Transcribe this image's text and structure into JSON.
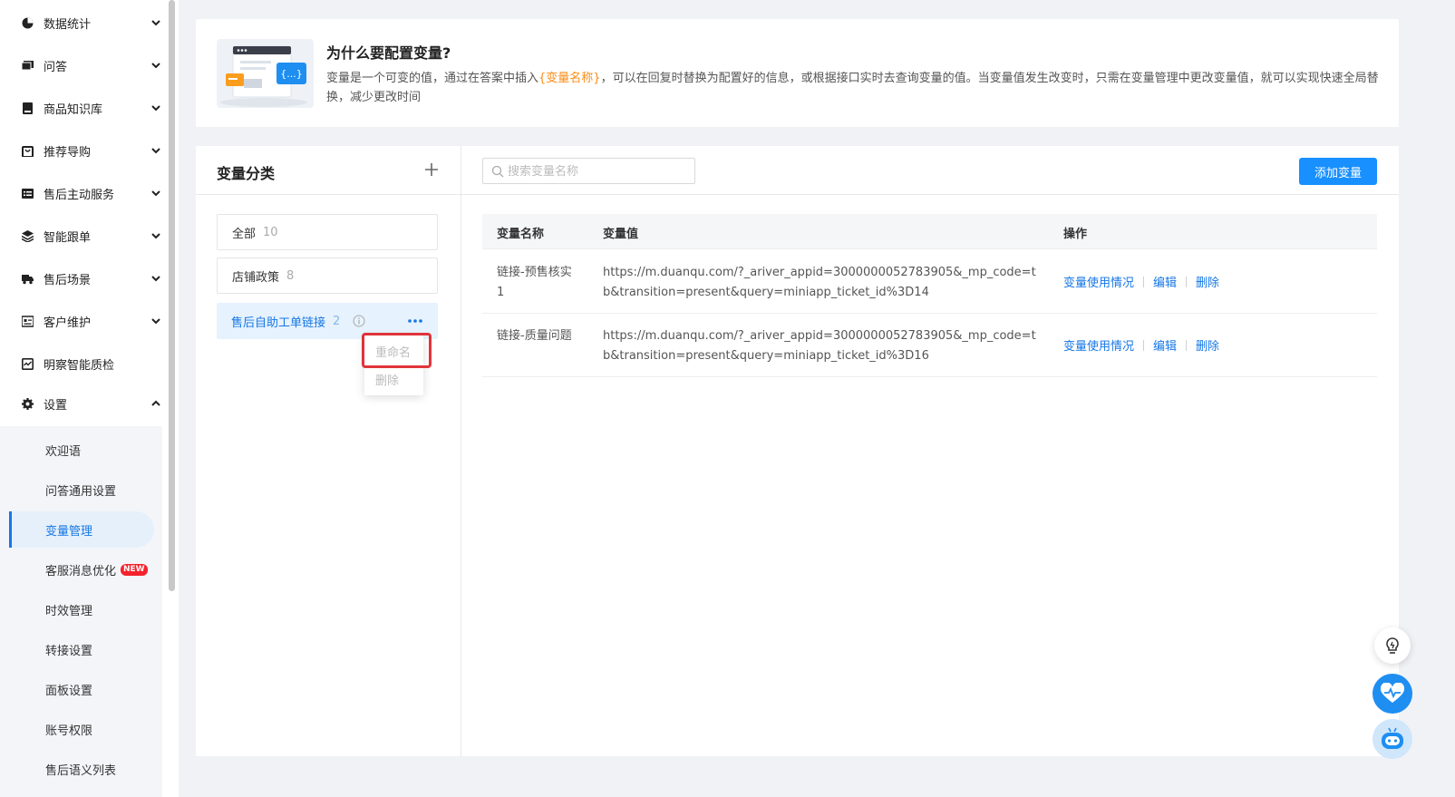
{
  "sidebar": {
    "items": [
      {
        "label": "数据统计",
        "icon": "pie-chart-icon"
      },
      {
        "label": "问答",
        "icon": "chat-icon"
      },
      {
        "label": "商品知识库",
        "icon": "book-icon"
      },
      {
        "label": "推荐导购",
        "icon": "shopping-bag-icon"
      },
      {
        "label": "售后主动服务",
        "icon": "list-icon"
      },
      {
        "label": "智能跟单",
        "icon": "layers-icon"
      },
      {
        "label": "售后场景",
        "icon": "truck-icon"
      },
      {
        "label": "客户维护",
        "icon": "id-card-icon"
      },
      {
        "label": "明察智能质检",
        "icon": "monitor-icon"
      },
      {
        "label": "设置",
        "icon": "gear-icon"
      }
    ],
    "submenu": [
      {
        "label": "欢迎语"
      },
      {
        "label": "问答通用设置"
      },
      {
        "label": "变量管理"
      },
      {
        "label": "客服消息优化",
        "badge": "NEW"
      },
      {
        "label": "时效管理"
      },
      {
        "label": "转接设置"
      },
      {
        "label": "面板设置"
      },
      {
        "label": "账号权限"
      },
      {
        "label": "售后语义列表"
      }
    ]
  },
  "intro": {
    "title": "为什么要配置变量?",
    "desc_before": "变量是一个可变的值，通过在答案中插入",
    "desc_highlight": "{变量名称}",
    "desc_after": "，可以在回复时替换为配置好的信息，或根据接口实时去查询变量的值。当变量值发生改变时，只需在变量管理中更改变量值，就可以实现快速全局替换，减少更改时间",
    "art_text": "{...}"
  },
  "categories": {
    "title": "变量分类",
    "items": [
      {
        "label": "全部",
        "count": "10"
      },
      {
        "label": "店铺政策",
        "count": "8"
      },
      {
        "label": "售后自助工单链接",
        "count": "2"
      }
    ],
    "menu": {
      "rename": "重命名",
      "delete": "删除"
    }
  },
  "variables": {
    "search_placeholder": "搜索变量名称",
    "add_label": "添加变量",
    "columns": {
      "name": "变量名称",
      "value": "变量值",
      "ops": "操作"
    },
    "rows": [
      {
        "name": "链接-预售核实1",
        "value": "https://m.duanqu.com/?_ariver_appid=3000000052783905&_mp_code=tb&transition=present&query=miniapp_ticket_id%3D14"
      },
      {
        "name": "链接-质量问题",
        "value": "https://m.duanqu.com/?_ariver_appid=3000000052783905&_mp_code=tb&transition=present&query=miniapp_ticket_id%3D16"
      }
    ],
    "ops": {
      "usage": "变量使用情况",
      "edit": "编辑",
      "delete": "删除"
    }
  },
  "colors": {
    "accent": "#1890ff",
    "highlight": "#fa8c16",
    "danger_box": "#e0343a"
  }
}
